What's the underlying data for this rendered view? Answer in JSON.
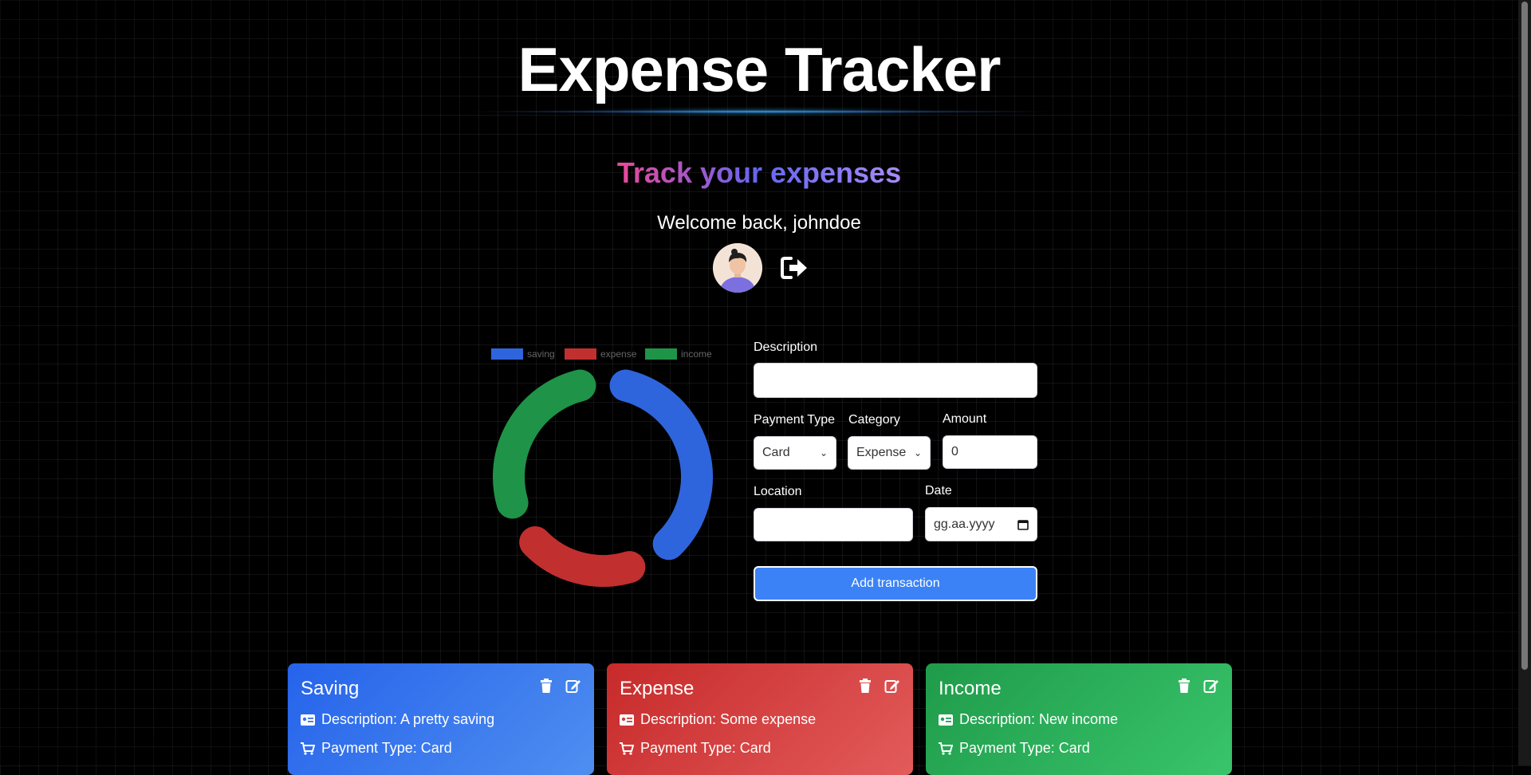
{
  "header": {
    "title": "Expense Tracker",
    "subtitle": "Track your expenses",
    "welcome": "Welcome back, johndoe"
  },
  "icons": {
    "avatar": "avatar",
    "logout": "logout-icon"
  },
  "chart_data": {
    "type": "doughnut",
    "categories": [
      "saving",
      "expense",
      "income"
    ],
    "values": [
      37,
      19,
      28
    ],
    "colors": [
      "#2f65dc",
      "#c22f2f",
      "#1f9348"
    ],
    "legend": "top"
  },
  "form": {
    "description_label": "Description",
    "description_value": "",
    "payment_type_label": "Payment Type",
    "payment_type_value": "Card",
    "category_label": "Category",
    "category_value": "Expense",
    "amount_label": "Amount",
    "amount_value": "0",
    "location_label": "Location",
    "location_value": "",
    "date_label": "Date",
    "date_placeholder": "gg.aa.yyyy",
    "submit_label": "Add transaction"
  },
  "cards": [
    {
      "title": "Saving",
      "description": "Description: A pretty saving",
      "payment": "Payment Type: Card"
    },
    {
      "title": "Expense",
      "description": "Description: Some expense",
      "payment": "Payment Type: Card"
    },
    {
      "title": "Income",
      "description": "Description: New income",
      "payment": "Payment Type: Card"
    }
  ]
}
